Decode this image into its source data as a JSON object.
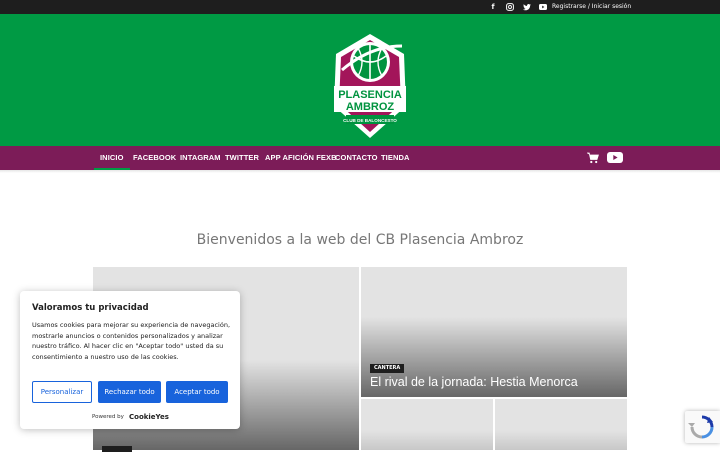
{
  "topbar": {
    "icons": [
      "facebook-icon",
      "instagram-icon",
      "twitter-icon",
      "youtube-icon"
    ],
    "login_text": "Registrarse / Iniciar sesión"
  },
  "logo": {
    "line1": "PLASENCIA",
    "line2": "AMBROZ",
    "line3": "CLUB DE BALONCESTO"
  },
  "nav": {
    "items": [
      {
        "label": "INICIO",
        "active": true
      },
      {
        "label": "FACEBOOK",
        "active": false
      },
      {
        "label": "INTAGRAM",
        "active": false
      },
      {
        "label": "TWITTER",
        "active": false
      },
      {
        "label": "APP AFICIÓN FEXB",
        "active": false
      },
      {
        "label": "CONTACTO",
        "active": false
      },
      {
        "label": "TIENDA",
        "active": false
      }
    ],
    "icons": [
      "cart-icon",
      "youtube-icon"
    ]
  },
  "main": {
    "welcome": "Bienvenidos a la web del CB Plasencia Ambroz",
    "featured": {
      "category": "CANTERA",
      "title": "El rival de la jornada: Hestia Menorca"
    }
  },
  "cookie": {
    "title": "Valoramos tu privacidad",
    "text": "Usamos cookies para mejorar su experiencia de navegación, mostrarle anuncios o contenidos personalizados y analizar nuestro tráfico. Al hacer clic en \"Aceptar todo\" usted da su consentimiento a nuestro uso de las cookies.",
    "customize_label": "Personalizar",
    "reject_label": "Rechazar todo",
    "accept_label": "Aceptar todo",
    "powered_by": "Powered by",
    "brand": "CookieYes"
  },
  "colors": {
    "header_green": "#009a44",
    "nav_purple": "#7c1c58",
    "topbar_dark": "#1e1e1e",
    "cookie_blue": "#1863dc"
  }
}
